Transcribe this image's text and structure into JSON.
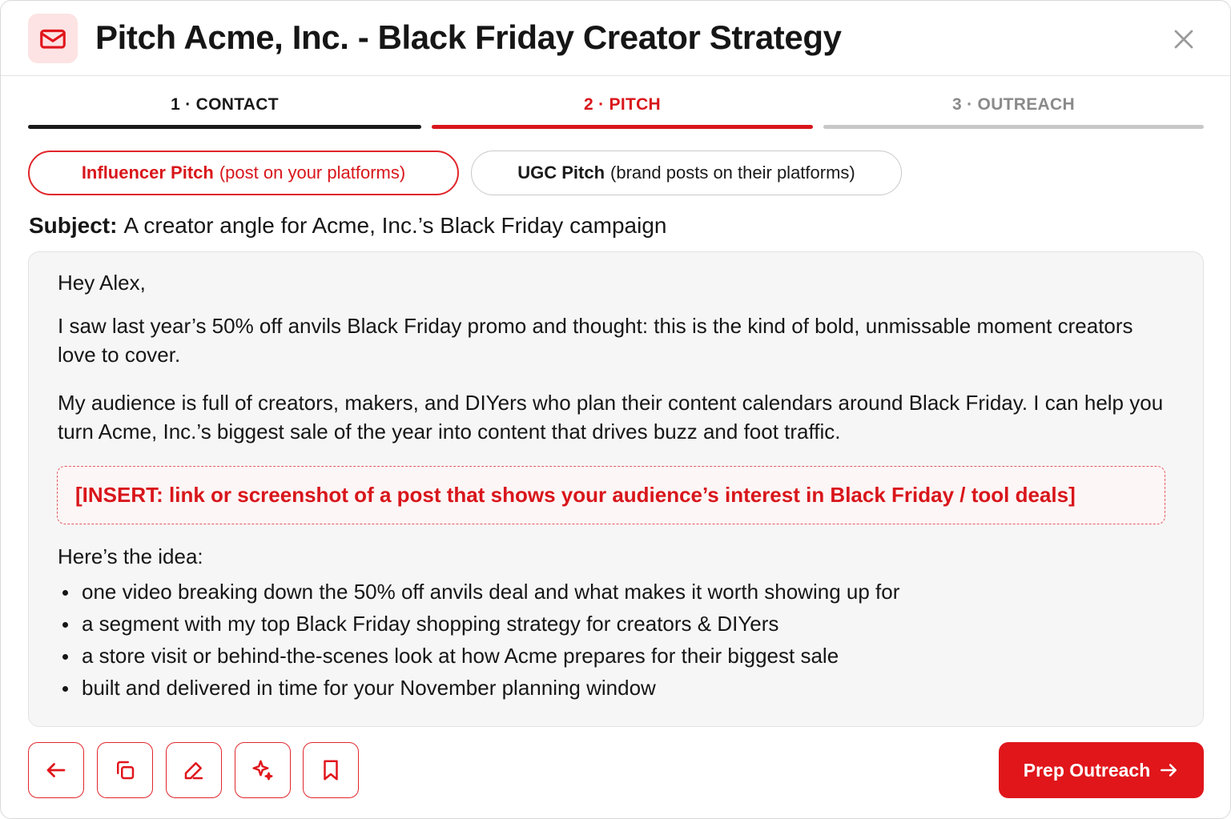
{
  "header": {
    "title": "Pitch Acme, Inc. - Black Friday Creator Strategy",
    "icon": "mail-icon",
    "close_icon": "close-icon"
  },
  "steps": [
    {
      "label": "1 · CONTACT",
      "state": "complete"
    },
    {
      "label": "2 · PITCH",
      "state": "active"
    },
    {
      "label": "3 · OUTREACH",
      "state": "upcoming"
    }
  ],
  "pitch_types": [
    {
      "name": "Influencer Pitch",
      "detail": "(post on your platforms)",
      "selected": true
    },
    {
      "name": "UGC Pitch",
      "detail": "(brand posts on their platforms)",
      "selected": false
    }
  ],
  "subject": {
    "label": "Subject:",
    "value": "A creator angle for Acme, Inc.’s Black Friday campaign"
  },
  "email": {
    "greeting": "Hey Alex,",
    "paragraph_1": "I saw last year’s 50% off anvils Black Friday promo and thought: this is the kind of bold, unmissable moment creators love to cover.",
    "paragraph_2": "My audience is full of creators, makers, and DIYers who plan their content calendars around Black Friday. I can help you turn Acme, Inc.’s biggest sale of the year into content that drives buzz and foot traffic.",
    "insert_placeholder": "[INSERT: link or screenshot of a post that shows your audience’s interest in Black Friday / tool deals]",
    "idea_label": "Here’s the idea:",
    "bullets": [
      "one video breaking down the 50% off anvils deal and what makes it worth showing up for",
      "a segment with my top Black Friday shopping strategy for creators & DIYers",
      "a store visit or behind-the-scenes look at how Acme prepares for their biggest sale",
      "built and delivered in time for your November planning window"
    ]
  },
  "footer": {
    "icon_buttons": [
      "back-arrow-icon",
      "copy-icon",
      "pencil-icon",
      "sparkle-icon",
      "bookmark-icon"
    ],
    "primary_label": "Prep Outreach",
    "primary_icon": "arrow-right-icon"
  },
  "colors": {
    "accent": "#e0161b",
    "accent_light": "#fde3e3",
    "text": "#161616",
    "muted": "#8a8a8a",
    "body_bg": "#f6f6f6"
  }
}
